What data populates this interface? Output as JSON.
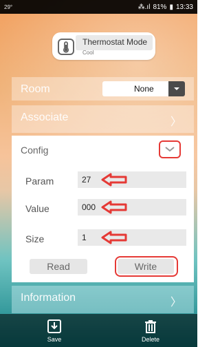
{
  "status_bar": {
    "left": "29°",
    "signal_text": "⁂.ıl",
    "battery": "81%",
    "time": "13:33"
  },
  "device": {
    "title": "Thermostat Mode",
    "subtitle": "Cool",
    "icon": "thermometer-icon"
  },
  "room": {
    "label": "Room",
    "value": "None"
  },
  "associate": {
    "label": "Associate",
    "arrow": "〉"
  },
  "config": {
    "label": "Config",
    "fields": {
      "param": {
        "label": "Param",
        "value": "27"
      },
      "value": {
        "label": "Value",
        "value": "000"
      },
      "size": {
        "label": "Size",
        "value": "1"
      }
    },
    "buttons": {
      "read": "Read",
      "write": "Write"
    }
  },
  "information": {
    "label": "Information",
    "arrow": "〉"
  },
  "bottom_bar": {
    "save": "Save",
    "delete": "Delete"
  },
  "colors": {
    "highlight_red": "#e53935",
    "panel_white": "#ffffff",
    "input_gray": "#e9e9e9"
  }
}
